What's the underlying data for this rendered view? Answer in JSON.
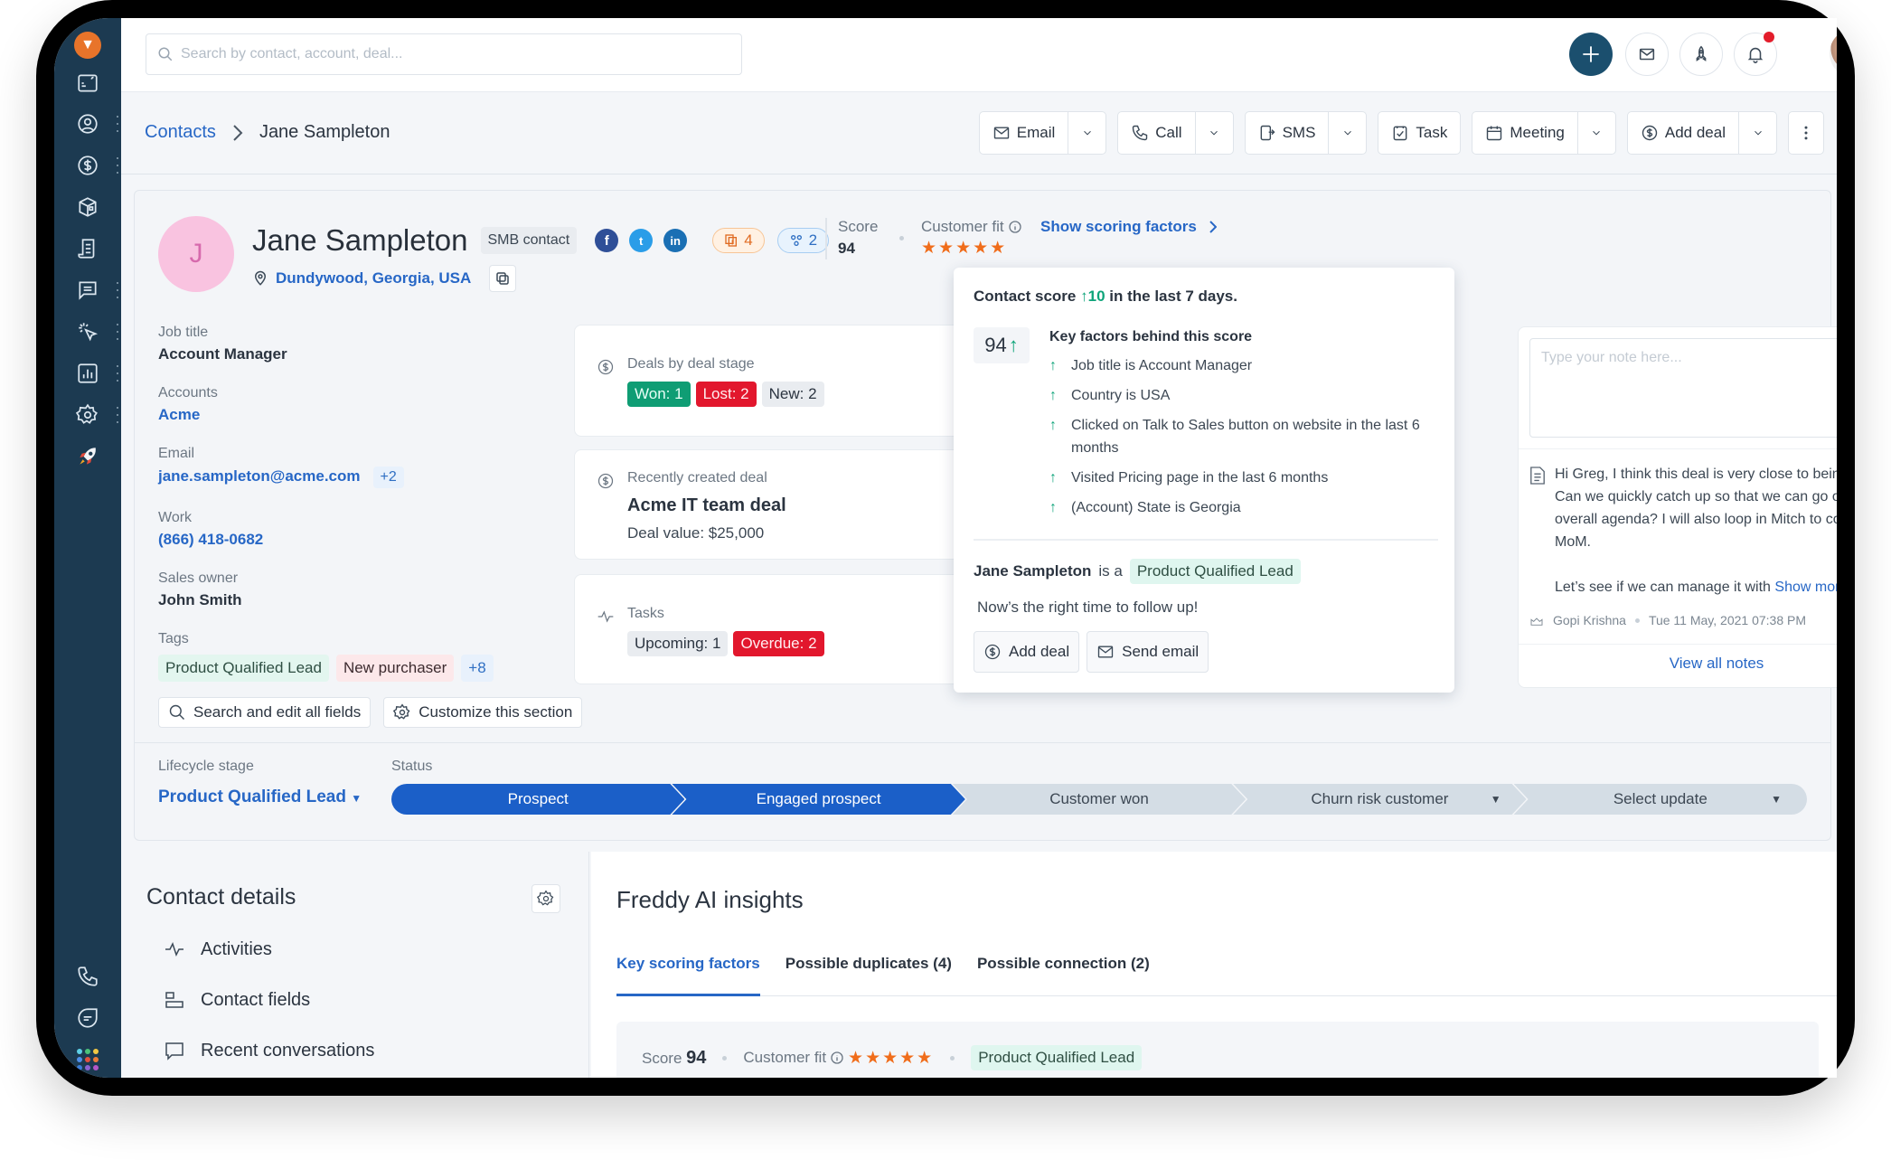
{
  "search": {
    "placeholder": "Search by contact, account, deal..."
  },
  "topbar": {
    "icons": [
      "plus-icon",
      "mail-icon",
      "rocket-icon",
      "bell-icon"
    ],
    "has_notification": true
  },
  "sidebar": {
    "items": [
      {
        "name": "dashboard",
        "dots": false
      },
      {
        "name": "contacts",
        "dots": true
      },
      {
        "name": "deals",
        "dots": true
      },
      {
        "name": "products",
        "dots": false
      },
      {
        "name": "documents",
        "dots": false
      },
      {
        "name": "conversations",
        "dots": true
      },
      {
        "name": "marketing",
        "dots": true
      },
      {
        "name": "reports",
        "dots": true
      },
      {
        "name": "settings",
        "dots": true
      },
      {
        "name": "rocket",
        "dots": false
      }
    ],
    "bottom": [
      "phone",
      "chat",
      "apps"
    ]
  },
  "breadcrumb": {
    "parent": "Contacts",
    "current": "Jane Sampleton"
  },
  "actions": [
    {
      "label": "Email",
      "icon": "mail-icon",
      "dropdown": true
    },
    {
      "label": "Call",
      "icon": "phone-icon",
      "dropdown": true
    },
    {
      "label": "SMS",
      "icon": "sms-icon",
      "dropdown": true
    },
    {
      "label": "Task",
      "icon": "task-icon",
      "dropdown": false
    },
    {
      "label": "Meeting",
      "icon": "calendar-icon",
      "dropdown": true
    },
    {
      "label": "Add deal",
      "icon": "dollar-icon",
      "dropdown": true
    }
  ],
  "contact": {
    "initial": "J",
    "name": "Jane Sampleton",
    "type": "SMB contact",
    "location": "Dundywood, Georgia, USA",
    "alerts_count": "4",
    "connections_count": "2",
    "score_label": "Score",
    "score": "94",
    "fit_label": "Customer fit",
    "fit_stars": 5,
    "scoring_link": "Show scoring factors"
  },
  "fields": {
    "job_title": {
      "label": "Job title",
      "value": "Account Manager"
    },
    "accounts": {
      "label": "Accounts",
      "value": "Acme"
    },
    "email": {
      "label": "Email",
      "value": "jane.sampleton@acme.com",
      "extra": "+2"
    },
    "work": {
      "label": "Work",
      "value": "(866) 418-0682"
    },
    "owner": {
      "label": "Sales owner",
      "value": "John Smith"
    },
    "tags": {
      "label": "Tags",
      "items": [
        "Product Qualified Lead",
        "New purchaser"
      ],
      "extra": "+8"
    }
  },
  "field_buttons": {
    "search": "Search and edit all fields",
    "customize": "Customize this section"
  },
  "cards": {
    "deals": {
      "title": "Deals by deal stage",
      "won": "Won: 1",
      "lost": "Lost: 2",
      "new": "New: 2"
    },
    "recent": {
      "title": "Recently created deal",
      "name": "Acme IT team deal",
      "value": "Deal value: $25,000"
    },
    "tasks": {
      "title": "Tasks",
      "upcoming": "Upcoming: 1",
      "overdue": "Overdue: 2"
    }
  },
  "popover": {
    "head_pre": "Contact score",
    "delta": "10",
    "head_post": "in the last 7 days.",
    "score": "94",
    "factors_title": "Key factors behind this score",
    "factors": [
      "Job title is Account Manager",
      "Country is USA",
      "Clicked on Talk to Sales button on website in the last 6 months",
      "Visited Pricing page in the last 6 months",
      "(Account) State is Georgia"
    ],
    "who": "Jane Sampleton",
    "is_a": "is a",
    "stage": "Product Qualified Lead",
    "follow": "Now’s the right time to follow up!",
    "add_deal": "Add deal",
    "send_email": "Send email"
  },
  "notes": {
    "placeholder": "Type your note here...",
    "body": "Hi Greg, I think this deal is very close to being closed. Can we quickly catch up so that we can go over the overall agenda? I will also loop in Mitch to cover the MoM.",
    "body2": "Let’s see if we can manage it with",
    "show_more": "Show more",
    "author": "Gopi Krishna",
    "time": "Tue 11 May, 2021 07:38 PM",
    "view_all": "View all notes"
  },
  "lifecycle": {
    "label": "Lifecycle stage",
    "value": "Product Qualified Lead",
    "status_label": "Status",
    "stages": [
      {
        "label": "Prospect",
        "active": true,
        "dropdown": false
      },
      {
        "label": "Engaged prospect",
        "active": true,
        "dropdown": false
      },
      {
        "label": "Customer won",
        "active": false,
        "dropdown": false
      },
      {
        "label": "Churn risk customer",
        "active": false,
        "dropdown": true
      },
      {
        "label": "Select update",
        "active": false,
        "dropdown": true
      }
    ]
  },
  "contact_details": {
    "title": "Contact details",
    "items": [
      "Activities",
      "Contact fields",
      "Recent conversations"
    ]
  },
  "freddy": {
    "title": "Freddy AI insights",
    "tabs": [
      "Key scoring factors",
      "Possible duplicates (4)",
      "Possible connection (2)"
    ],
    "active_tab": 0,
    "score_label": "Score",
    "score": "94",
    "fit_label": "Customer fit",
    "stage": "Product Qualified Lead"
  }
}
